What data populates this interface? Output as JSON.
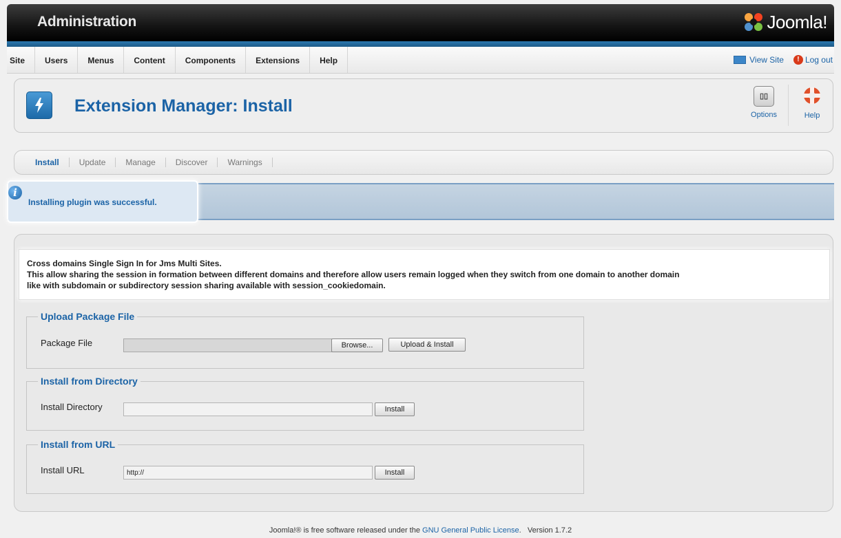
{
  "header": {
    "title": "Administration",
    "logo_text": "Joomla!"
  },
  "menu": {
    "items": [
      "Site",
      "Users",
      "Menus",
      "Content",
      "Components",
      "Extensions",
      "Help"
    ],
    "view_site": "View Site",
    "log_out": "Log out"
  },
  "toolbar": {
    "page_title": "Extension Manager: Install",
    "options_label": "Options",
    "help_label": "Help"
  },
  "tabs": [
    "Install",
    "Update",
    "Manage",
    "Discover",
    "Warnings"
  ],
  "message": {
    "text": "Installing plugin was successful."
  },
  "description": {
    "line1": "Cross domains Single Sign In for Jms Multi Sites.",
    "line2": "This allow sharing the session in formation between different domains and therefore allow users remain logged when they switch from one domain to another domain",
    "line3": "like with subdomain or subdirectory session sharing available with session_cookiedomain."
  },
  "upload": {
    "legend": "Upload Package File",
    "label": "Package File",
    "browse_label": "Browse...",
    "submit_label": "Upload & Install"
  },
  "directory": {
    "legend": "Install from Directory",
    "label": "Install Directory",
    "value": "",
    "submit_label": "Install"
  },
  "url": {
    "legend": "Install from URL",
    "label": "Install URL",
    "value": "http://",
    "submit_label": "Install"
  },
  "footer": {
    "before": "Joomla!® is free software released under the ",
    "link": "GNU General Public License",
    "after": ".   Version 1.7.2"
  }
}
